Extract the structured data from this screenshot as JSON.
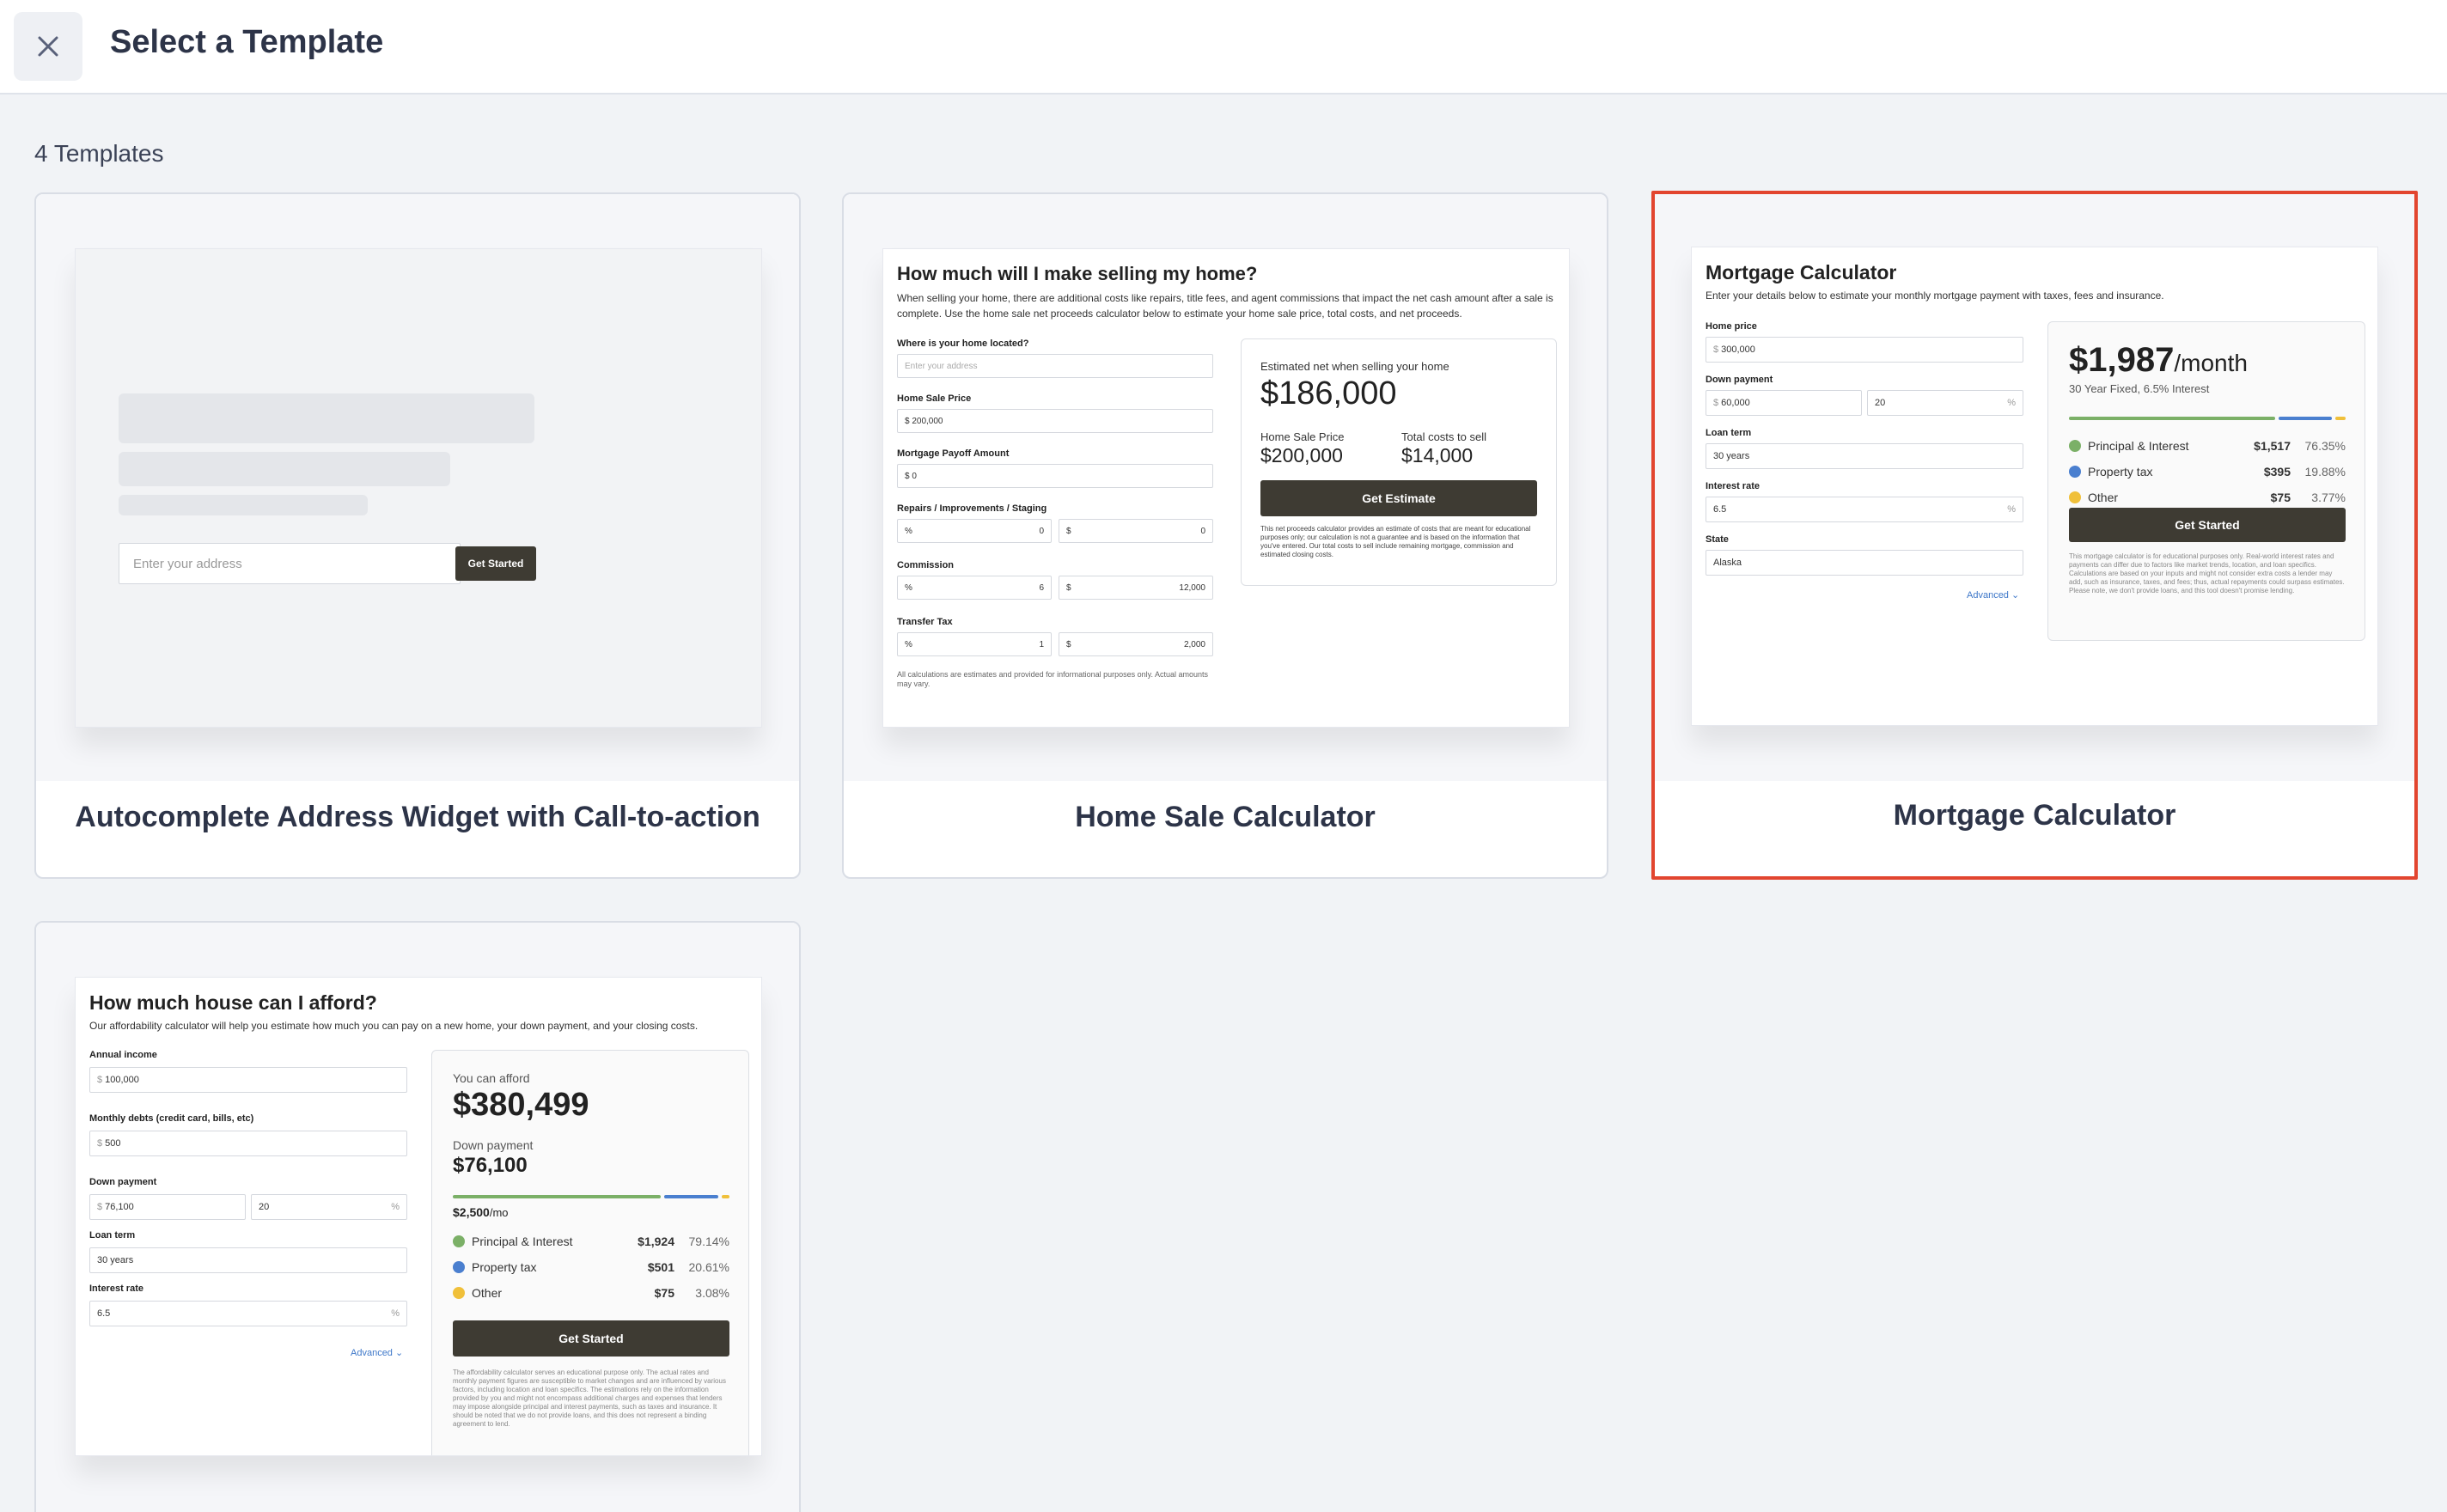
{
  "header": {
    "title": "Select a Template",
    "close_icon": "close-icon"
  },
  "templates_count": "4 Templates",
  "cards": [
    {
      "label": "Autocomplete Address Widget with Call-to-action",
      "preview": {
        "placeholder": "Enter your address",
        "button": "Get Started"
      }
    },
    {
      "label": "Home Sale Calculator",
      "preview": {
        "heading": "How much will I make selling my home?",
        "intro": "When selling your home, there are additional costs like repairs, title fees, and agent commissions that impact the net cash amount after a sale is complete. Use the home sale net proceeds calculator below to estimate your home sale price, total costs, and net proceeds.",
        "location_label": "Where is your home located?",
        "address_placeholder": "Enter your address",
        "price_label": "Home Sale Price",
        "price_value": "$ 200,000",
        "payoff_label": "Mortgage Payoff Amount",
        "payoff_value": "$ 0",
        "repairs_label": "Repairs / Improvements / Staging",
        "repairs_pct_unit": "%",
        "repairs_pct": "0",
        "repairs_usd_unit": "$",
        "repairs_usd": "0",
        "commission_label": "Commission",
        "commission_pct_unit": "%",
        "commission_pct": "6",
        "commission_usd_unit": "$",
        "commission_usd": "12,000",
        "transfer_label": "Transfer Tax",
        "transfer_pct_unit": "%",
        "transfer_pct": "1",
        "transfer_usd_unit": "$",
        "transfer_usd": "2,000",
        "footnote": "All calculations are estimates and provided for informational purposes only. Actual amounts may vary.",
        "est_label": "Estimated net when selling your home",
        "est_value": "$186,000",
        "sale_price_label": "Home Sale Price",
        "sale_price_value": "$200,000",
        "costs_label": "Total costs to sell",
        "costs_value": "$14,000",
        "button": "Get Estimate",
        "disclaimer": "This net proceeds calculator provides an estimate of costs that are meant for educational purposes only; our calculation is not a guarantee and is based on the information that you've entered. Our total costs to sell include remaining mortgage, commission and estimated closing costs."
      }
    },
    {
      "label": "Mortgage Calculator",
      "selected": true,
      "preview": {
        "heading": "Mortgage Calculator",
        "intro": "Enter your details below to estimate your monthly mortgage payment with taxes, fees and insurance.",
        "home_price_label": "Home price",
        "home_price_unit": "$",
        "home_price": "300,000",
        "down_label": "Down payment",
        "down_unit": "$",
        "down_value": "60,000",
        "down_pct": "20",
        "pct_unit": "%",
        "term_label": "Loan term",
        "term_value": "30 years",
        "rate_label": "Interest rate",
        "rate_value": "6.5",
        "rate_unit": "%",
        "state_label": "State",
        "state_value": "Alaska",
        "advanced": "Advanced",
        "payment": "$1,987",
        "per": "/month",
        "loan_desc": "30 Year Fixed, 6.5% Interest",
        "breakdown": [
          {
            "name": "Principal & Interest",
            "amount": "$1,517",
            "pct": "76.35%",
            "share": 76.35,
            "color": "#7bb067"
          },
          {
            "name": "Property tax",
            "amount": "$395",
            "pct": "19.88%",
            "share": 19.88,
            "color": "#4a7fcf"
          },
          {
            "name": "Other",
            "amount": "$75",
            "pct": "3.77%",
            "share": 3.77,
            "color": "#f0c03a"
          }
        ],
        "button": "Get Started",
        "disclaimer": "This mortgage calculator is for educational purposes only. Real-world interest rates and payments can differ due to factors like market trends, location, and loan specifics. Calculations are based on your inputs and might not consider extra costs a lender may add, such as insurance, taxes, and fees; thus, actual repayments could surpass estimates. Please note, we don't provide loans, and this tool doesn't promise lending."
      }
    },
    {
      "label": "",
      "preview": {
        "heading": "How much house can I afford?",
        "intro": "Our affordability calculator will help you estimate how much you can pay on a new home, your down payment, and your closing costs.",
        "income_label": "Annual income",
        "income_unit": "$",
        "income_value": "100,000",
        "debts_label": "Monthly debts (credit card, bills, etc)",
        "debts_unit": "$",
        "debts_value": "500",
        "down_label": "Down payment",
        "down_unit": "$",
        "down_value": "76,100",
        "down_pct": "20",
        "pct_unit": "%",
        "term_label": "Loan term",
        "term_value": "30 years",
        "rate_label": "Interest rate",
        "rate_value": "6.5",
        "rate_unit": "%",
        "advanced": "Advanced",
        "afford_label": "You can afford",
        "afford_value": "$380,499",
        "down_payment_label": "Down payment",
        "down_payment_value": "$76,100",
        "monthly": "$2,500",
        "monthly_unit": "/mo",
        "breakdown": [
          {
            "name": "Principal & Interest",
            "amount": "$1,924",
            "pct": "79.14%",
            "share": 79.14,
            "color": "#7bb067"
          },
          {
            "name": "Property tax",
            "amount": "$501",
            "pct": "20.61%",
            "share": 20.61,
            "color": "#4a7fcf"
          },
          {
            "name": "Other",
            "amount": "$75",
            "pct": "3.08%",
            "share": 3.08,
            "color": "#f0c03a"
          }
        ],
        "button": "Get Started",
        "disclaimer": "The affordability calculator serves an educational purpose only. The actual rates and monthly payment figures are susceptible to market changes and are influenced by various factors, including location and loan specifics. The estimations rely on the information provided by you and might not encompass additional charges and expenses that lenders may impose alongside principal and interest payments, such as taxes and insurance. It should be noted that we do not provide loans, and this does not represent a binding agreement to lend."
      }
    }
  ]
}
